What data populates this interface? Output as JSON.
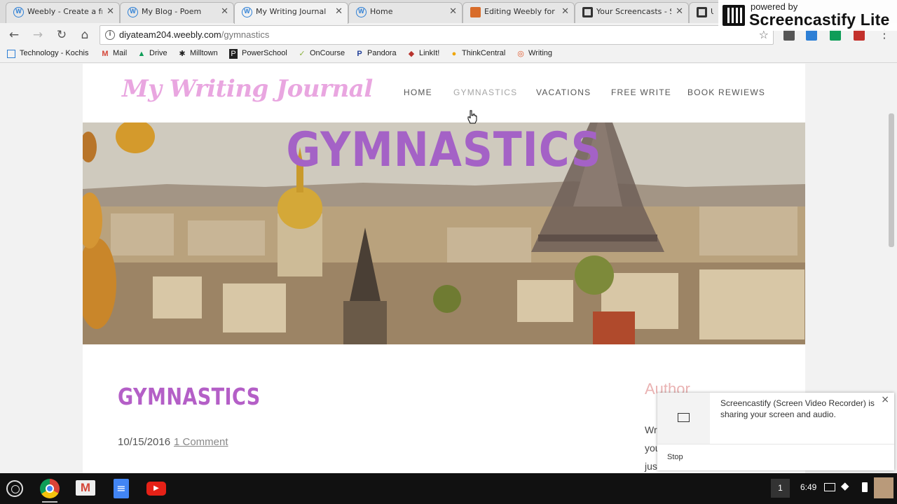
{
  "tabs": [
    {
      "label": "Weebly - Create a fre",
      "icon": "weebly-icon"
    },
    {
      "label": "My Blog - Poem",
      "icon": "weebly-icon"
    },
    {
      "label": "My Writing Journal",
      "icon": "weebly-icon"
    },
    {
      "label": "Home",
      "icon": "weebly-icon"
    },
    {
      "label": "Editing Weebly for",
      "icon": "edit-icon"
    },
    {
      "label": "Your Screencasts - S",
      "icon": "film-icon"
    },
    {
      "label": "Ur",
      "icon": "film-icon"
    }
  ],
  "watermark": {
    "small": "powered by",
    "big": "Screencastify Lite"
  },
  "address": {
    "host": "diyateam204.weebly.com",
    "path": "/gymnastics"
  },
  "bookmarks": [
    {
      "label": "Technology - Kochis",
      "icon": "apps-icon"
    },
    {
      "label": "Mail",
      "icon": "gmail-icon"
    },
    {
      "label": "Drive",
      "icon": "drive-icon"
    },
    {
      "label": "Milltown",
      "icon": "milltown-icon"
    },
    {
      "label": "PowerSchool",
      "icon": "powerschool-icon"
    },
    {
      "label": "OnCourse",
      "icon": "oncourse-icon"
    },
    {
      "label": "Pandora",
      "icon": "pandora-icon"
    },
    {
      "label": "LinkIt!",
      "icon": "linkit-icon"
    },
    {
      "label": "ThinkCentral",
      "icon": "thinkcentral-icon"
    },
    {
      "label": "Writing",
      "icon": "writing-icon"
    }
  ],
  "site": {
    "logo": "My Writing Journal",
    "nav": [
      "HOME",
      "GYMNASTICS",
      "VACATIONS",
      "FREE WRITE",
      "BOOK REWIEWS"
    ],
    "hero_title": "GYMNASTICS",
    "post_title": "GYMNASTICS",
    "post_date": "10/15/2016",
    "post_comments": "1 Comment",
    "author_heading": "Author",
    "author_lines": [
      "Wr",
      "you",
      "jus"
    ]
  },
  "notification": {
    "text": "Screencastify (Screen Video Recorder) is sharing your screen and audio.",
    "stop": "Stop",
    "close": "×"
  },
  "shelf": {
    "badge": "1",
    "time": "6:49"
  }
}
